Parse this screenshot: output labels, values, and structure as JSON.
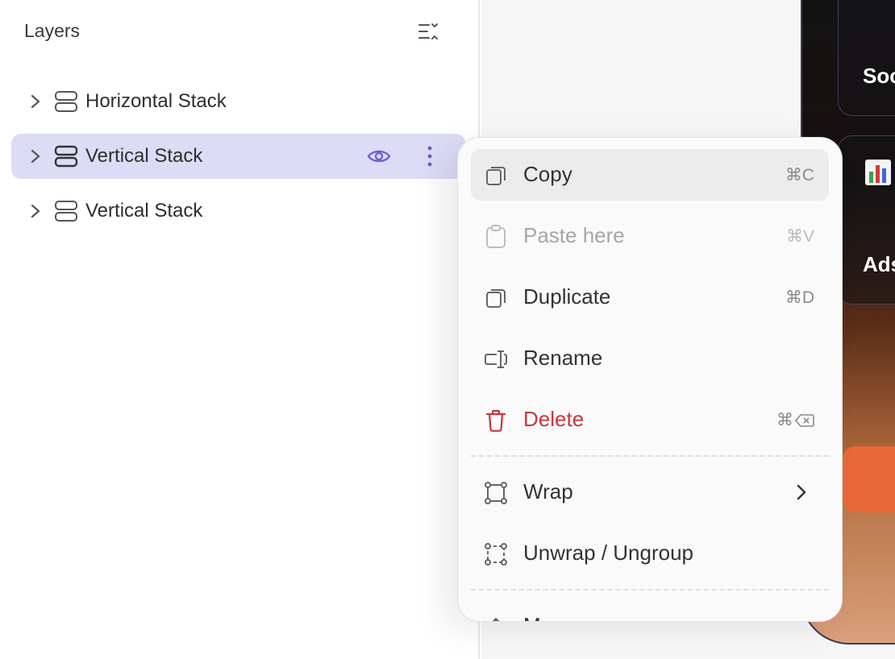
{
  "layers": {
    "title": "Layers",
    "items": [
      {
        "label": "Horizontal Stack",
        "selected": false
      },
      {
        "label": "Vertical Stack",
        "selected": true
      },
      {
        "label": "Vertical Stack",
        "selected": false
      }
    ]
  },
  "canvas": {
    "cards": [
      "Soc",
      "Ads"
    ]
  },
  "context_menu": {
    "items": [
      {
        "label": "Copy",
        "shortcut": "⌘C",
        "icon": "copy-icon"
      },
      {
        "label": "Paste here",
        "shortcut": "⌘V",
        "icon": "clipboard-icon",
        "disabled": true
      },
      {
        "label": "Duplicate",
        "shortcut": "⌘D",
        "icon": "duplicate-icon"
      },
      {
        "label": "Rename",
        "shortcut": "",
        "icon": "rename-icon"
      },
      {
        "label": "Delete",
        "shortcut": "⌘",
        "icon": "trash-icon",
        "danger": true
      },
      {
        "label": "Wrap",
        "icon": "wrap-icon",
        "has_submenu": true
      },
      {
        "label": "Unwrap / Ungroup",
        "icon": "unwrap-icon"
      },
      {
        "label": "Move up",
        "icon": "arrow-up-icon"
      }
    ]
  },
  "colors": {
    "selection": "#dcdcf6",
    "accent": "#6b5bd6",
    "danger": "#c9373f"
  }
}
